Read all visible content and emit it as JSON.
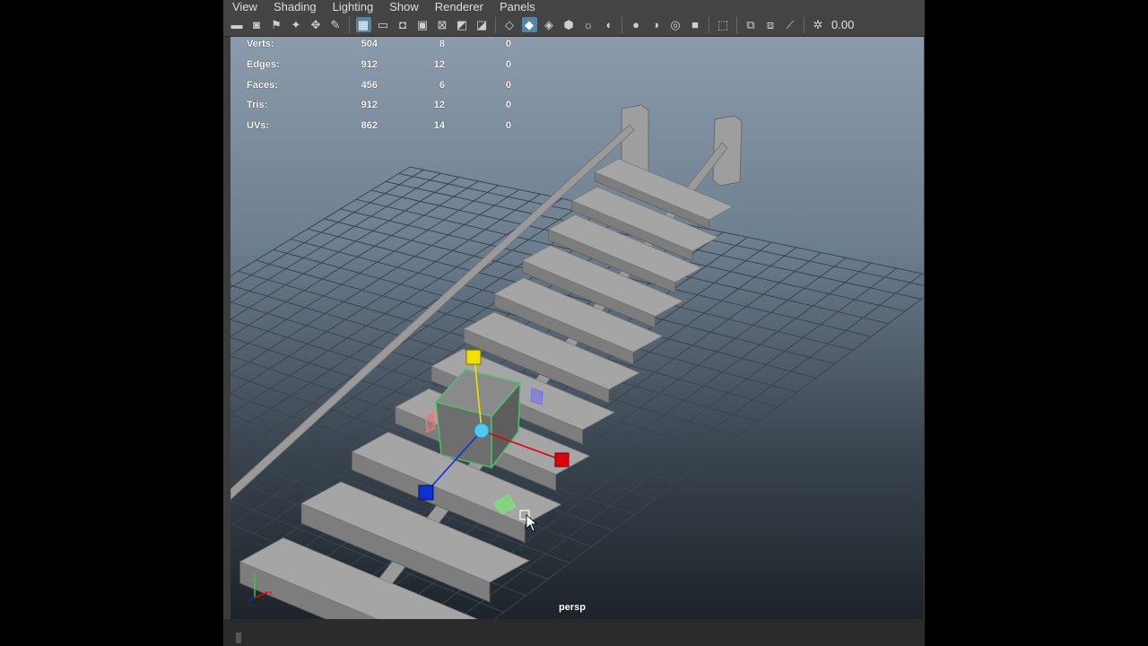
{
  "menu": [
    "View",
    "Shading",
    "Lighting",
    "Show",
    "Renderer",
    "Panels"
  ],
  "toolbar": {
    "icons": [
      "camera-select-icon",
      "camera-attributes-icon",
      "bookmark-icon",
      "image-plane-icon",
      "move-tool-icon",
      "grease-pencil-icon",
      "grid-icon",
      "film-gate-icon",
      "resolution-gate-icon",
      "gate-mask-icon",
      "field-chart-icon",
      "safe-action-icon",
      "safe-title-icon",
      "wireframe-icon",
      "smooth-shade-icon",
      "wireframe-on-shaded-icon",
      "textured-icon",
      "use-all-lights-icon",
      "shadows-icon",
      "ambient-occlusion-icon",
      "motion-blur-icon",
      "anti-alias-icon",
      "isolate-select-icon",
      "xray-icon",
      "xray-joints-icon",
      "backface-culling-icon",
      "color-management-icon"
    ],
    "exposure_value": "0.00"
  },
  "hud": {
    "rows": [
      {
        "label": "Verts:",
        "v1": "504",
        "v2": "8",
        "v3": "0"
      },
      {
        "label": "Edges:",
        "v1": "912",
        "v2": "12",
        "v3": "0"
      },
      {
        "label": "Faces:",
        "v1": "456",
        "v2": "6",
        "v3": "0"
      },
      {
        "label": "Tris:",
        "v1": "912",
        "v2": "12",
        "v3": "0"
      },
      {
        "label": "UVs:",
        "v1": "862",
        "v2": "14",
        "v3": "0"
      }
    ]
  },
  "viewport": {
    "camera": "persp",
    "colors": {
      "grid": "#3b4450",
      "plank": "#a5a5a5",
      "rope": "#9a9a9a",
      "selection": "#4ec36e",
      "axis_x": "#e0000b",
      "axis_y": "#f0e000",
      "axis_z": "#1030d0",
      "center": "#54c8f0"
    }
  }
}
